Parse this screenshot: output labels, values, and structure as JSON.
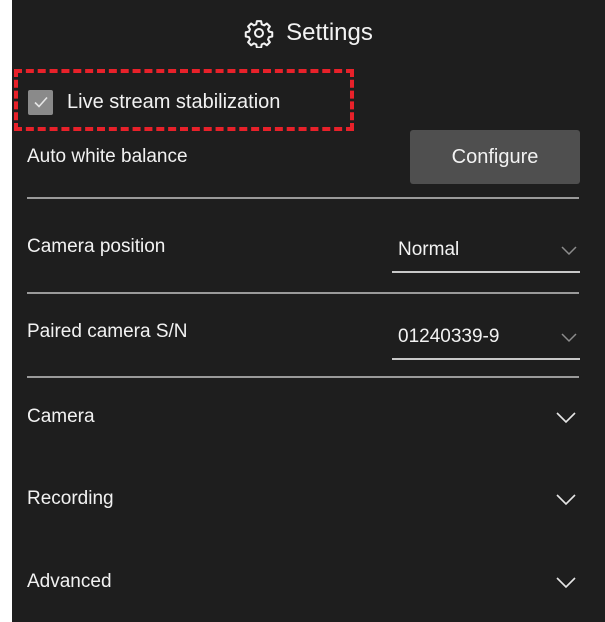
{
  "header": {
    "title": "Settings",
    "icon": "gear-icon"
  },
  "live_stream": {
    "label": "Live stream stabilization",
    "checked": true
  },
  "white_balance": {
    "label": "Auto white balance",
    "button_label": "Configure"
  },
  "camera_position": {
    "label": "Camera position",
    "value": "Normal"
  },
  "paired_camera": {
    "label": "Paired camera S/N",
    "value": "01240339-9"
  },
  "sections": [
    {
      "label": "Camera"
    },
    {
      "label": "Recording"
    },
    {
      "label": "Advanced"
    }
  ],
  "colors": {
    "panel_bg": "#1e1e1e",
    "text": "#f2f2f2",
    "button_bg": "#4f4f4f",
    "checkbox_bg": "#8a8a8a",
    "highlight": "#e8212a",
    "divider": "#9a9a9a"
  }
}
